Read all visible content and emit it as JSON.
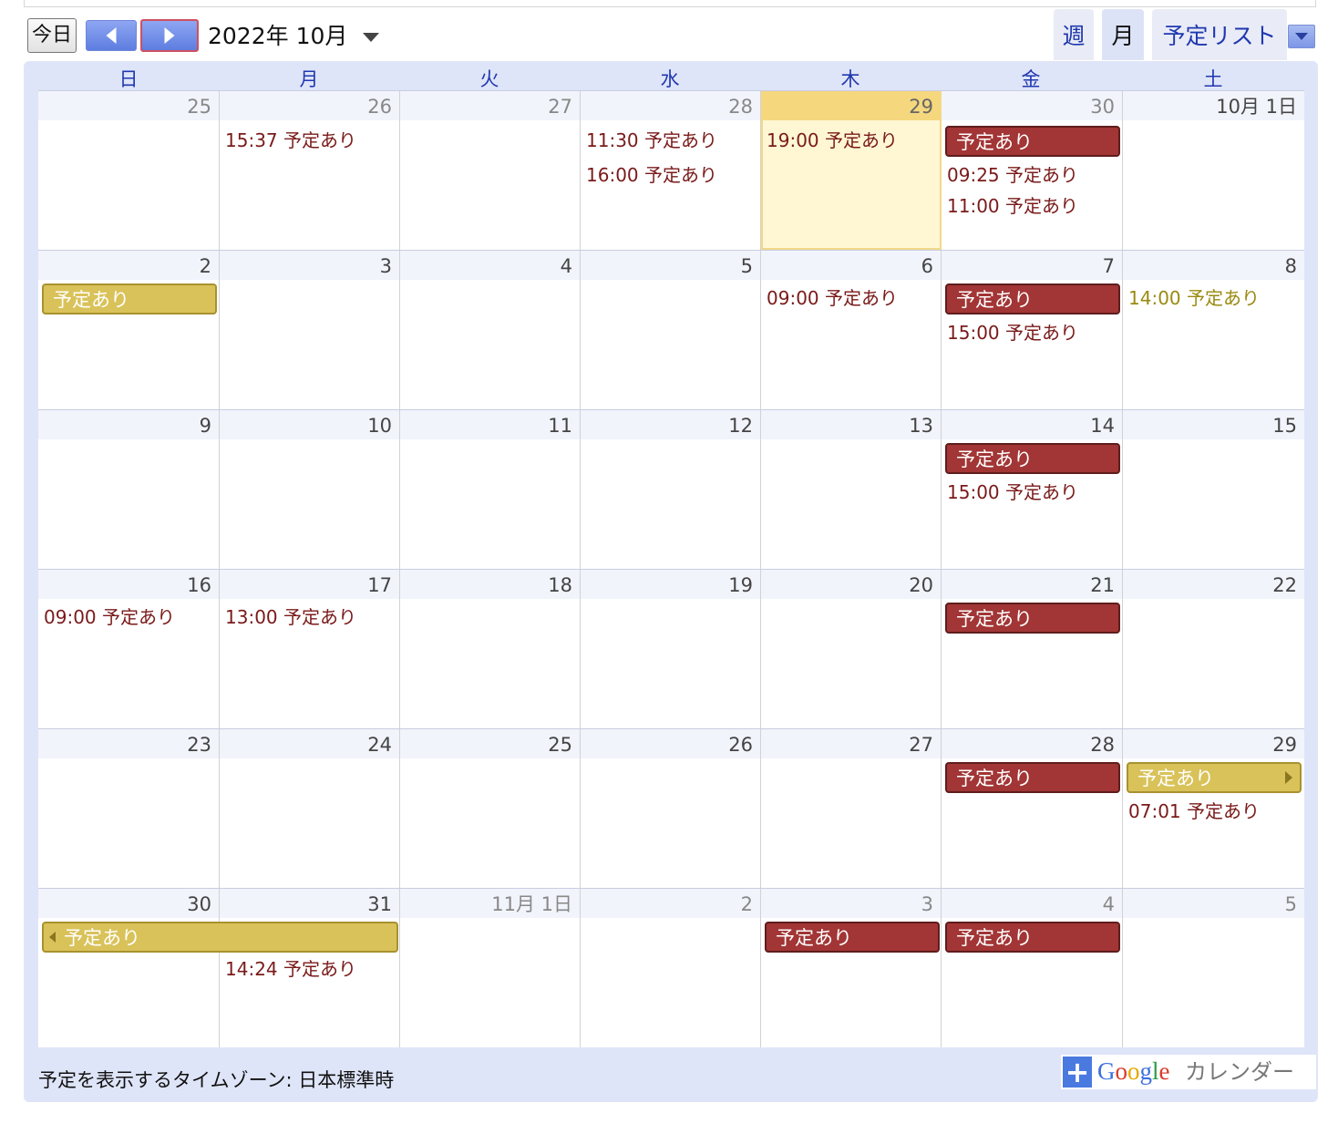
{
  "toolbar": {
    "today_label": "今日",
    "month_title": "2022年 10月",
    "views": {
      "week": "週",
      "month": "月",
      "agenda": "予定リスト"
    }
  },
  "weekdays": [
    "日",
    "月",
    "火",
    "水",
    "木",
    "金",
    "土"
  ],
  "weeks": [
    [
      "25",
      "26",
      "27",
      "28",
      "29",
      "30",
      "10月 1日"
    ],
    [
      "2",
      "3",
      "4",
      "5",
      "6",
      "7",
      "8"
    ],
    [
      "9",
      "10",
      "11",
      "12",
      "13",
      "14",
      "15"
    ],
    [
      "16",
      "17",
      "18",
      "19",
      "20",
      "21",
      "22"
    ],
    [
      "23",
      "24",
      "25",
      "26",
      "27",
      "28",
      "29"
    ],
    [
      "30",
      "31",
      "11月 1日",
      "2",
      "3",
      "4",
      "5"
    ]
  ],
  "events": {
    "w0_mon": "15:37 予定あり",
    "w0_wed_1": "11:30 予定あり",
    "w0_wed_2": "16:00 予定あり",
    "w0_thu": "19:00 予定あり",
    "w0_fri_bar": "予定あり",
    "w0_fri_1": "09:25 予定あり",
    "w0_fri_2": "11:00 予定あり",
    "w1_sun_bar": "予定あり",
    "w1_thu": "09:00 予定あり",
    "w1_fri_bar": "予定あり",
    "w1_fri_1": "15:00 予定あり",
    "w1_sat": "14:00 予定あり",
    "w2_fri_bar": "予定あり",
    "w2_fri_1": "15:00 予定あり",
    "w3_sun": "09:00 予定あり",
    "w3_mon": "13:00 予定あり",
    "w3_fri_bar": "予定あり",
    "w4_fri_bar": "予定あり",
    "w4_sat_bar": "予定あり",
    "w4_sat_1": "07:01 予定あり",
    "w5_sunmon_bar": "予定あり",
    "w5_mon_1": "14:24 予定あり",
    "w5_thu_bar": "予定あり",
    "w5_fri_bar": "予定あり"
  },
  "footer": {
    "timezone": "予定を表示するタイムゾーン: 日本標準時",
    "gcal_logo": [
      "G",
      "o",
      "o",
      "g",
      "l",
      "e"
    ],
    "gcal_label": "カレンダー"
  },
  "colors": {
    "accent": "#2038b0",
    "event_red": "#a23535",
    "event_gold": "#d9c259",
    "today_bg": "#fff7d4"
  }
}
